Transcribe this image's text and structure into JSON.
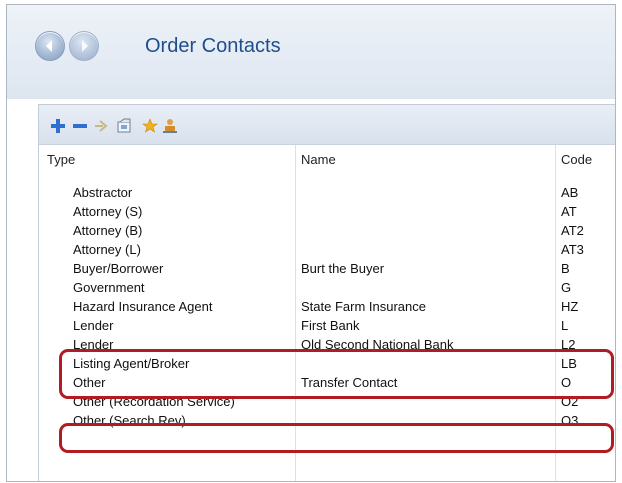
{
  "header": {
    "title": "Order Contacts"
  },
  "toolbar": {
    "icons": [
      "add-icon",
      "remove-icon",
      "arrow-icon",
      "open-icon",
      "star-icon",
      "user-stamp-icon"
    ],
    "colors": {
      "add": "#2e6fcf",
      "remove": "#2e6fcf",
      "star": "#f2b01e"
    }
  },
  "columns": {
    "type": "Type",
    "name": "Name",
    "code": "Code"
  },
  "rows": [
    {
      "type": "Abstractor",
      "name": "",
      "code": "AB"
    },
    {
      "type": "Attorney (S)",
      "name": "",
      "code": "AT"
    },
    {
      "type": "Attorney (B)",
      "name": "",
      "code": "AT2"
    },
    {
      "type": "Attorney (L)",
      "name": "",
      "code": "AT3"
    },
    {
      "type": "Buyer/Borrower",
      "name": "Burt the Buyer",
      "code": "B"
    },
    {
      "type": "Government",
      "name": "",
      "code": "G"
    },
    {
      "type": "Hazard Insurance Agent",
      "name": "State Farm Insurance",
      "code": "HZ"
    },
    {
      "type": "Lender",
      "name": "First Bank",
      "code": "L"
    },
    {
      "type": "Lender",
      "name": "Old Second National Bank",
      "code": "L2"
    },
    {
      "type": "Listing Agent/Broker",
      "name": "",
      "code": "LB"
    },
    {
      "type": "Other",
      "name": "Transfer Contact",
      "code": "O"
    },
    {
      "type": "Other (Recordation Service)",
      "name": "",
      "code": "O2"
    },
    {
      "type": "Other (Search Rev)",
      "name": "",
      "code": "O3"
    }
  ],
  "highlight_color": "#b01c22"
}
